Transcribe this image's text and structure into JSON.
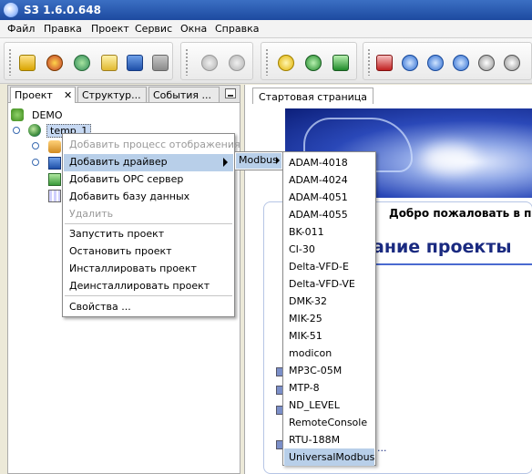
{
  "window": {
    "title": "S3 1.6.0.648"
  },
  "menubar": [
    "Файл",
    "Правка",
    "Проект",
    "Сервис",
    "Окна",
    "Справка"
  ],
  "left_panel": {
    "tabs": [
      "Проект",
      "Структур...",
      "События ..."
    ],
    "close_symbol": "✕",
    "tree": {
      "root": "DEMO",
      "selected_node": "temp_1"
    }
  },
  "right_panel": {
    "tab": "Стартовая страница",
    "welcome_text": "Добро пожаловать в п",
    "heading_fragment": "ание проекты",
    "footer_fragment": "..."
  },
  "context_menu": {
    "items": [
      {
        "label": "Добавить процесс отображения",
        "disabled": true
      },
      {
        "label": "Добавить драйвер",
        "highlight": true,
        "submenu": true
      },
      {
        "label": "Добавить OPC сервер"
      },
      {
        "label": "Добавить базу данных"
      },
      {
        "label": "Удалить",
        "disabled": true
      },
      {
        "label": "Запустить проект"
      },
      {
        "label": "Остановить проект"
      },
      {
        "label": "Инсталлировать проект"
      },
      {
        "label": "Деинсталлировать проект"
      },
      {
        "label": "Свойства ..."
      }
    ]
  },
  "modbus_submenu": {
    "label": "Modbus"
  },
  "driver_submenu": {
    "items": [
      "ADAM-4018",
      "ADAM-4024",
      "ADAM-4051",
      "ADAM-4055",
      "BK-011",
      "CI-30",
      "Delta-VFD-E",
      "Delta-VFD-VE",
      "DMK-32",
      "MIK-25",
      "MIK-51",
      "modicon",
      "MP3C-05M",
      "MTP-8",
      "ND_LEVEL",
      "RemoteConsole",
      "RTU-188M",
      "UniversalModbus"
    ],
    "highlighted": "UniversalModbus"
  },
  "colors": {
    "title_bar": "#2a5bb5",
    "menu_highlight": "#b8cfe9",
    "heading": "#1a2a80"
  }
}
